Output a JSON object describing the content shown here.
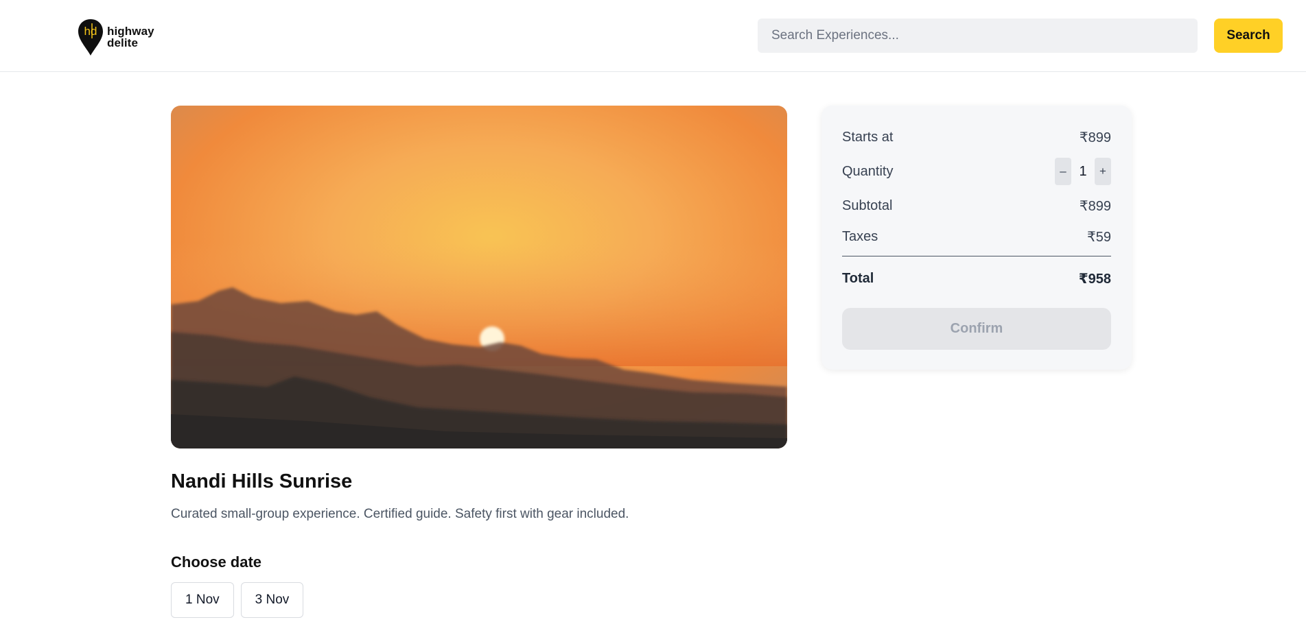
{
  "header": {
    "logo_line1": "highway",
    "logo_line2": "delite",
    "logo_mark": "hd",
    "search_placeholder": "Search Experiences...",
    "search_value": "",
    "search_label": "Search"
  },
  "experience": {
    "image": "sunrise-over-hills-photo",
    "title": "Nandi Hills Sunrise",
    "description": "Curated small-group experience. Certified guide. Safety first with gear included.",
    "choose_date_heading": "Choose date",
    "dates": [
      "1 Nov",
      "3 Nov"
    ]
  },
  "summary": {
    "starts_at_label": "Starts at",
    "starts_at_value": "₹899",
    "quantity_label": "Quantity",
    "quantity_minus": "–",
    "quantity_value": "1",
    "quantity_plus": "+",
    "subtotal_label": "Subtotal",
    "subtotal_value": "₹899",
    "taxes_label": "Taxes",
    "taxes_value": "₹59",
    "total_label": "Total",
    "total_value": "₹958",
    "confirm_label": "Confirm",
    "confirm_enabled": false
  },
  "colors": {
    "accent": "#ffd026",
    "card_bg": "#f6f7f9",
    "confirm_disabled_bg": "#e4e5e8",
    "confirm_disabled_text": "#9ca3af"
  },
  "icons": {
    "logo": "map-pin-logo-icon",
    "minus": "minus-icon",
    "plus": "plus-icon"
  }
}
